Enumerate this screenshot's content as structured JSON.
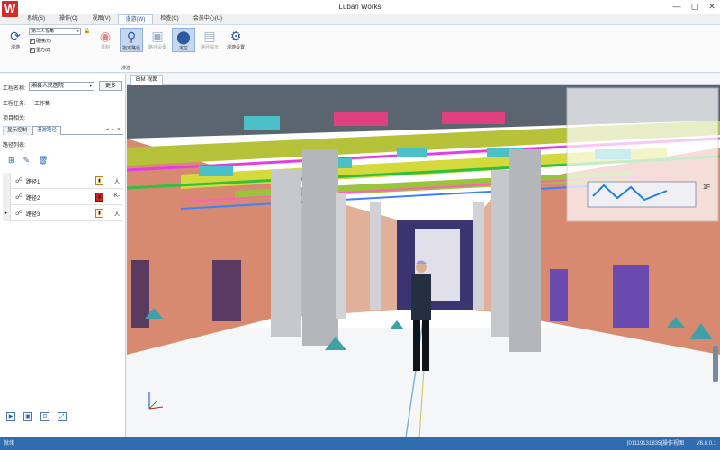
{
  "window": {
    "title": "Luban Works",
    "logo": "W",
    "controls": [
      "—",
      "▢",
      "✕"
    ]
  },
  "menu": [
    {
      "label": "系统(S)",
      "active": false
    },
    {
      "label": "操作(O)",
      "active": false
    },
    {
      "label": "视图(V)",
      "active": false
    },
    {
      "label": "漫游(W)",
      "active": true
    },
    {
      "label": "检查(C)",
      "active": false
    },
    {
      "label": "会员中心(U)",
      "active": false
    }
  ],
  "ribbon": {
    "roam_label": "漫游",
    "mode_combo": "第三人视角",
    "checkbox_collision": "碰撞(C)",
    "checkbox_gravity": "重力(Z)",
    "buttons": [
      {
        "label": "录制",
        "icon": "record-icon",
        "glyph": "◉",
        "selected": false,
        "disabled": true
      },
      {
        "label": "指定路径",
        "icon": "path-icon",
        "glyph": "⚲",
        "selected": true,
        "disabled": false
      },
      {
        "label": "路径设置",
        "icon": "vehicle-icon",
        "glyph": "▣",
        "selected": false,
        "disabled": true
      },
      {
        "label": "定位",
        "icon": "locate-icon",
        "glyph": "⬤",
        "selected": true,
        "disabled": false
      },
      {
        "label": "路径提示",
        "icon": "hint-icon",
        "glyph": "▤",
        "selected": false,
        "disabled": true
      },
      {
        "label": "漫游设置",
        "icon": "gear-icon",
        "glyph": "⚙",
        "selected": false,
        "disabled": false
      }
    ],
    "group_label": "漫游"
  },
  "left_panel": {
    "project_label": "工程名称:",
    "project_value": "湘县人民医院",
    "more_button": "更多",
    "task_label": "工程任务:",
    "task_value": "工作集",
    "related_label": "项目相关:",
    "tabs": [
      {
        "label": "显示控制",
        "active": false
      },
      {
        "label": "漫游路径",
        "active": true
      }
    ],
    "tab_arrows": "◂ ▸ ✕",
    "path_list_label": "路径列表:",
    "path_toolbar": [
      "add-path-icon",
      "edit-path-icon",
      "delete-path-icon"
    ],
    "paths": [
      {
        "name": "路径1",
        "badge": "▮",
        "badge_red": false,
        "flag": "人",
        "current": false
      },
      {
        "name": "路径2",
        "badge": "▮",
        "badge_red": true,
        "flag": "K-",
        "current": false
      },
      {
        "name": "路径3",
        "badge": "▮",
        "badge_red": false,
        "flag": "人",
        "current": true
      }
    ],
    "bottom_buttons": [
      "▶",
      "▣",
      "⊡",
      "⤢"
    ]
  },
  "viewport": {
    "tab": "BIM 视图",
    "minimap_floor": "1F"
  },
  "status": {
    "left": "就绪",
    "right": "[01119131835]操作视图",
    "version": "V6.8.0.1"
  }
}
